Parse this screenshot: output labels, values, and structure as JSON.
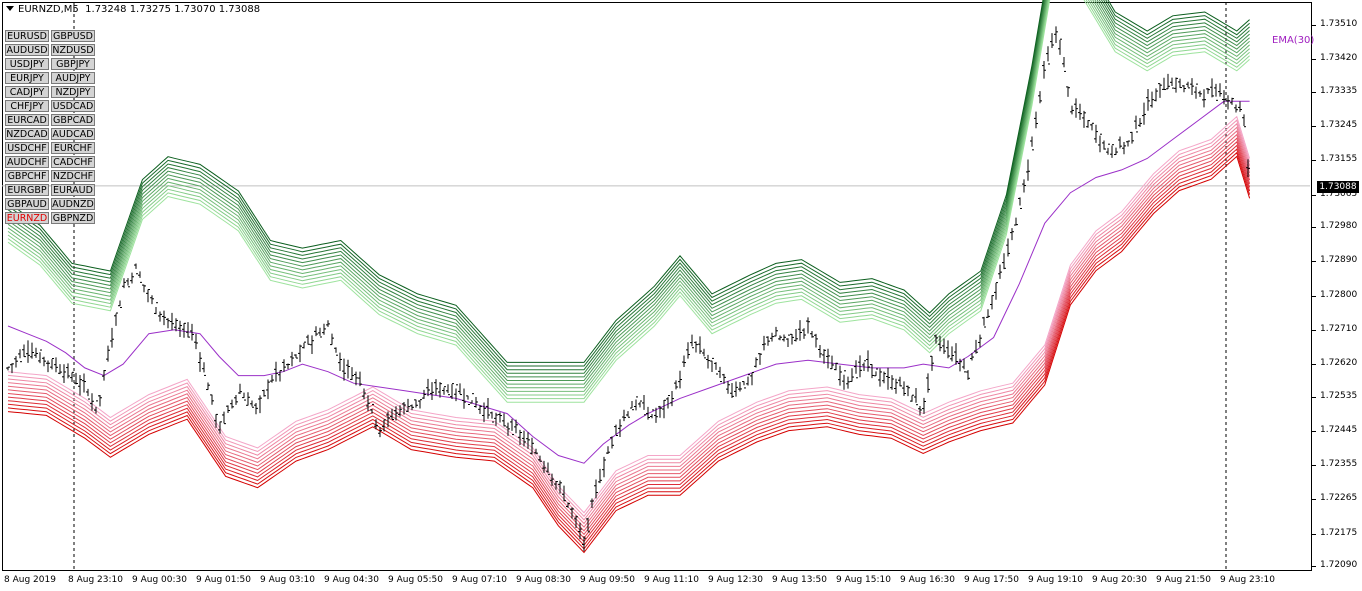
{
  "header": {
    "symbol_timeframe": "EURNZD,M5",
    "ohlc": "1.73248 1.73275 1.73070 1.73088"
  },
  "symbol_buttons": [
    "EURUSD",
    "GBPUSD",
    "AUDUSD",
    "NZDUSD",
    "USDJPY",
    "GBPJPY",
    "EURJPY",
    "AUDJPY",
    "CADJPY",
    "NZDJPY",
    "CHFJPY",
    "USDCAD",
    "EURCAD",
    "GBPCAD",
    "NZDCAD",
    "AUDCAD",
    "USDCHF",
    "EURCHF",
    "AUDCHF",
    "CADCHF",
    "GBPCHF",
    "NZDCHF",
    "EURGBP",
    "EURAUD",
    "GBPAUD",
    "AUDNZD",
    "EURNZD",
    "GBPNZD"
  ],
  "active_symbol": "EURNZD",
  "indicator_label": "EMA(30)",
  "current_price": "1.73088",
  "colors": {
    "ema": "#9b30c8",
    "upper_band_dark": "#0b5e1e",
    "upper_band_light": "#9ee39e",
    "lower_band_dark": "#d40000",
    "lower_band_light": "#f4a6c8",
    "active_symbol": "#e00000"
  },
  "chart_data": {
    "type": "line",
    "series_kind": "price bars with EMA ribbons",
    "ylim": [
      1.7209,
      1.73555
    ],
    "y_ticks": [
      "1.73510",
      "1.73420",
      "1.73335",
      "1.73245",
      "1.73155",
      "1.73065",
      "1.72980",
      "1.72890",
      "1.72800",
      "1.72710",
      "1.72620",
      "1.72535",
      "1.72445",
      "1.72355",
      "1.72265",
      "1.72175",
      "1.72090"
    ],
    "x_ticks": [
      "8 Aug 2019",
      "8 Aug 23:10",
      "9 Aug 00:30",
      "9 Aug 01:50",
      "9 Aug 03:10",
      "9 Aug 04:30",
      "9 Aug 05:50",
      "9 Aug 07:10",
      "9 Aug 08:30",
      "9 Aug 09:50",
      "9 Aug 11:10",
      "9 Aug 12:30",
      "9 Aug 13:50",
      "9 Aug 15:10",
      "9 Aug 16:30",
      "9 Aug 17:50",
      "9 Aug 19:10",
      "9 Aug 20:30",
      "9 Aug 21:50",
      "9 Aug 23:10"
    ],
    "session_separators": [
      "8 Aug 23:10",
      "9 Aug 23:10"
    ],
    "current_price": 1.73088,
    "ema30": [
      [
        0,
        1.7272
      ],
      [
        0.3,
        1.727
      ],
      [
        0.6,
        1.7268
      ],
      [
        0.9,
        1.7265
      ],
      [
        1.2,
        1.7261
      ],
      [
        1.5,
        1.7259
      ],
      [
        1.8,
        1.7262
      ],
      [
        2.2,
        1.727
      ],
      [
        2.6,
        1.7271
      ],
      [
        3.0,
        1.727
      ],
      [
        3.3,
        1.7264
      ],
      [
        3.6,
        1.7259
      ],
      [
        4.0,
        1.7259
      ],
      [
        4.3,
        1.726
      ],
      [
        4.6,
        1.7262
      ],
      [
        5.0,
        1.726
      ],
      [
        5.4,
        1.7257
      ],
      [
        5.8,
        1.7256
      ],
      [
        6.2,
        1.7255
      ],
      [
        6.6,
        1.7254
      ],
      [
        7.0,
        1.7253
      ],
      [
        7.4,
        1.7251
      ],
      [
        7.8,
        1.7249
      ],
      [
        8.2,
        1.7243
      ],
      [
        8.6,
        1.7238
      ],
      [
        9.0,
        1.7236
      ],
      [
        9.3,
        1.7241
      ],
      [
        9.7,
        1.7246
      ],
      [
        10.0,
        1.7249
      ],
      [
        10.5,
        1.7253
      ],
      [
        11.0,
        1.7256
      ],
      [
        11.5,
        1.7259
      ],
      [
        12.0,
        1.7262
      ],
      [
        12.5,
        1.7263
      ],
      [
        13.0,
        1.7262
      ],
      [
        13.5,
        1.7261
      ],
      [
        14.0,
        1.7261
      ],
      [
        14.3,
        1.7262
      ],
      [
        14.7,
        1.7261
      ],
      [
        15.0,
        1.7264
      ],
      [
        15.4,
        1.7269
      ],
      [
        15.8,
        1.7283
      ],
      [
        16.2,
        1.7299
      ],
      [
        16.6,
        1.7307
      ],
      [
        17.0,
        1.7311
      ],
      [
        17.4,
        1.7313
      ],
      [
        17.8,
        1.7316
      ],
      [
        18.2,
        1.7321
      ],
      [
        18.6,
        1.7326
      ],
      [
        19.0,
        1.7331
      ],
      [
        19.4,
        1.7331
      ]
    ],
    "price_path": [
      [
        0,
        1.7261
      ],
      [
        0.3,
        1.7266
      ],
      [
        0.6,
        1.7263
      ],
      [
        0.9,
        1.726
      ],
      [
        1.2,
        1.7256
      ],
      [
        1.4,
        1.725
      ],
      [
        1.6,
        1.7268
      ],
      [
        1.8,
        1.7282
      ],
      [
        2.0,
        1.7287
      ],
      [
        2.3,
        1.7277
      ],
      [
        2.6,
        1.7272
      ],
      [
        2.9,
        1.727
      ],
      [
        3.1,
        1.7258
      ],
      [
        3.3,
        1.7245
      ],
      [
        3.6,
        1.7255
      ],
      [
        3.9,
        1.725
      ],
      [
        4.1,
        1.7258
      ],
      [
        4.4,
        1.7262
      ],
      [
        4.7,
        1.7268
      ],
      [
        5.0,
        1.7272
      ],
      [
        5.2,
        1.7262
      ],
      [
        5.5,
        1.7258
      ],
      [
        5.8,
        1.7245
      ],
      [
        6.1,
        1.725
      ],
      [
        6.4,
        1.7252
      ],
      [
        6.7,
        1.7256
      ],
      [
        7.0,
        1.7255
      ],
      [
        7.3,
        1.7252
      ],
      [
        7.6,
        1.7248
      ],
      [
        7.9,
        1.7245
      ],
      [
        8.2,
        1.724
      ],
      [
        8.5,
        1.7233
      ],
      [
        8.8,
        1.7224
      ],
      [
        9.0,
        1.7215
      ],
      [
        9.2,
        1.723
      ],
      [
        9.5,
        1.7245
      ],
      [
        9.8,
        1.7252
      ],
      [
        10.1,
        1.7248
      ],
      [
        10.4,
        1.7254
      ],
      [
        10.7,
        1.7268
      ],
      [
        11.0,
        1.7262
      ],
      [
        11.3,
        1.7255
      ],
      [
        11.6,
        1.7258
      ],
      [
        11.9,
        1.727
      ],
      [
        12.2,
        1.7268
      ],
      [
        12.5,
        1.7272
      ],
      [
        12.8,
        1.7263
      ],
      [
        13.1,
        1.7258
      ],
      [
        13.4,
        1.7262
      ],
      [
        13.7,
        1.7258
      ],
      [
        14.0,
        1.7256
      ],
      [
        14.3,
        1.725
      ],
      [
        14.5,
        1.7268
      ],
      [
        14.8,
        1.7264
      ],
      [
        15.0,
        1.726
      ],
      [
        15.3,
        1.7275
      ],
      [
        15.6,
        1.729
      ],
      [
        15.9,
        1.731
      ],
      [
        16.2,
        1.734
      ],
      [
        16.4,
        1.735
      ],
      [
        16.6,
        1.733
      ],
      [
        16.9,
        1.7325
      ],
      [
        17.2,
        1.7318
      ],
      [
        17.5,
        1.732
      ],
      [
        17.8,
        1.733
      ],
      [
        18.1,
        1.7336
      ],
      [
        18.4,
        1.7335
      ],
      [
        18.7,
        1.7333
      ],
      [
        19.0,
        1.7333
      ],
      [
        19.3,
        1.7328
      ],
      [
        19.4,
        1.7309
      ]
    ],
    "upper_ribbon_base": [
      [
        0,
        1.7294
      ],
      [
        0.5,
        1.7288
      ],
      [
        1.0,
        1.7278
      ],
      [
        1.6,
        1.7276
      ],
      [
        2.1,
        1.73
      ],
      [
        2.5,
        1.7306
      ],
      [
        3.0,
        1.7304
      ],
      [
        3.6,
        1.7297
      ],
      [
        4.1,
        1.7284
      ],
      [
        4.6,
        1.7282
      ],
      [
        5.2,
        1.7284
      ],
      [
        5.8,
        1.7275
      ],
      [
        6.4,
        1.727
      ],
      [
        7.0,
        1.7267
      ],
      [
        7.8,
        1.7252
      ],
      [
        8.4,
        1.7252
      ],
      [
        9.0,
        1.7252
      ],
      [
        9.5,
        1.7263
      ],
      [
        10.1,
        1.7272
      ],
      [
        10.5,
        1.728
      ],
      [
        11.0,
        1.727
      ],
      [
        11.6,
        1.7275
      ],
      [
        12.0,
        1.7278
      ],
      [
        12.4,
        1.7279
      ],
      [
        13.0,
        1.7273
      ],
      [
        13.5,
        1.7274
      ],
      [
        14.0,
        1.7271
      ],
      [
        14.4,
        1.7265
      ],
      [
        14.7,
        1.727
      ],
      [
        15.2,
        1.7276
      ],
      [
        15.6,
        1.7296
      ],
      [
        16.0,
        1.733
      ],
      [
        16.3,
        1.736
      ],
      [
        16.8,
        1.7358
      ],
      [
        17.3,
        1.7344
      ],
      [
        17.8,
        1.7339
      ],
      [
        18.2,
        1.7343
      ],
      [
        18.7,
        1.7344
      ],
      [
        19.2,
        1.7339
      ],
      [
        19.4,
        1.7342
      ]
    ],
    "lower_ribbon_base": [
      [
        0,
        1.726
      ],
      [
        0.6,
        1.7259
      ],
      [
        1.2,
        1.7253
      ],
      [
        1.6,
        1.7248
      ],
      [
        2.2,
        1.7254
      ],
      [
        2.8,
        1.7258
      ],
      [
        3.4,
        1.7243
      ],
      [
        3.9,
        1.724
      ],
      [
        4.5,
        1.7247
      ],
      [
        5.0,
        1.725
      ],
      [
        5.7,
        1.7256
      ],
      [
        6.3,
        1.725
      ],
      [
        7.0,
        1.7248
      ],
      [
        7.6,
        1.7247
      ],
      [
        8.2,
        1.724
      ],
      [
        8.6,
        1.723
      ],
      [
        9.0,
        1.7223
      ],
      [
        9.5,
        1.7234
      ],
      [
        10.0,
        1.7238
      ],
      [
        10.5,
        1.7238
      ],
      [
        11.1,
        1.7247
      ],
      [
        11.7,
        1.7252
      ],
      [
        12.2,
        1.7255
      ],
      [
        12.8,
        1.7256
      ],
      [
        13.3,
        1.7254
      ],
      [
        13.8,
        1.7253
      ],
      [
        14.3,
        1.7249
      ],
      [
        14.7,
        1.7252
      ],
      [
        15.2,
        1.7255
      ],
      [
        15.7,
        1.7257
      ],
      [
        16.2,
        1.7267
      ],
      [
        16.6,
        1.7288
      ],
      [
        17.0,
        1.7297
      ],
      [
        17.4,
        1.7302
      ],
      [
        17.9,
        1.7312
      ],
      [
        18.3,
        1.7318
      ],
      [
        18.8,
        1.7321
      ],
      [
        19.2,
        1.7327
      ],
      [
        19.4,
        1.7316
      ]
    ]
  }
}
